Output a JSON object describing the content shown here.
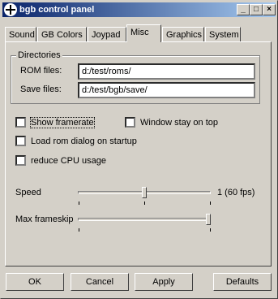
{
  "window": {
    "title": "bgb control panel",
    "min": "_",
    "max": "□",
    "close": "×"
  },
  "tabs": [
    "Sound",
    "GB Colors",
    "Joypad",
    "Misc",
    "Graphics",
    "System"
  ],
  "active_tab": "Misc",
  "directories": {
    "group_label": "Directories",
    "rom_label": "ROM files:",
    "rom_value": "d:/test/roms/",
    "save_label": "Save files:",
    "save_value": "d:/test/bgb/save/"
  },
  "options": {
    "show_framerate": {
      "label": "Show framerate",
      "checked": false
    },
    "window_on_top": {
      "label": "Window stay on top",
      "checked": false
    },
    "load_rom_dialog": {
      "label": "Load rom dialog on startup",
      "checked": false
    },
    "reduce_cpu": {
      "label": "reduce CPU usage",
      "checked": false
    }
  },
  "speed": {
    "label": "Speed",
    "value_text": "1 (60 fps)",
    "level": 0.5
  },
  "frameskip": {
    "label": "Max frameskip",
    "level": 1.0
  },
  "buttons": {
    "ok": "OK",
    "cancel": "Cancel",
    "apply": "Apply",
    "defaults": "Defaults"
  }
}
